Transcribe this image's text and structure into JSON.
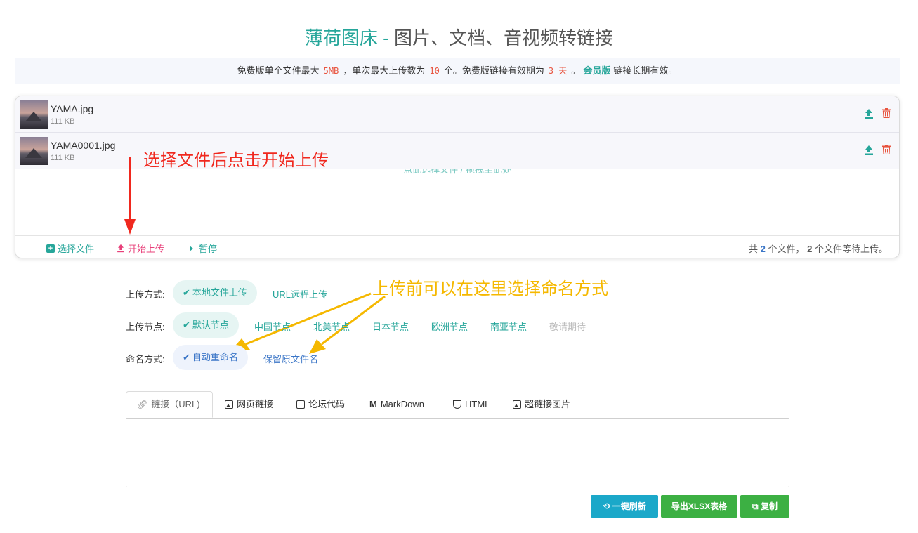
{
  "header": {
    "brand": "薄荷图床",
    "separator": " - ",
    "subtitle": "图片、文档、音视频转链接"
  },
  "notice": {
    "part1": "免费版单个文件最大",
    "max_size": "5MB",
    "part2": "，单次最大上传数为",
    "max_count": "10",
    "part3": "个。免费版链接有效期为",
    "expire": "3 天",
    "part4": "。",
    "vip": "会员版",
    "part5": "链接长期有效。"
  },
  "files": [
    {
      "name": "YAMA.jpg",
      "size": "111 KB"
    },
    {
      "name": "YAMA0001.jpg",
      "size": "111 KB"
    }
  ],
  "uploader": {
    "drop_hint": "点此选择文件 / 拖拽至此处",
    "select_label": "选择文件",
    "start_label": "开始上传",
    "pause_label": "暂停",
    "count_prefix": "共",
    "count_total": "2",
    "count_mid": "个文件，",
    "count_waiting": "2",
    "count_suffix": "个文件等待上传。"
  },
  "annotations": {
    "red": "选择文件后点击开始上传",
    "yellow": "上传前可以在这里选择命名方式"
  },
  "options": {
    "upload_method": {
      "label": "上传方式:",
      "items": [
        "本地文件上传",
        "URL远程上传"
      ],
      "selected": "本地文件上传"
    },
    "upload_node": {
      "label": "上传节点:",
      "items": [
        "默认节点",
        "中国节点",
        "北美节点",
        "日本节点",
        "欧洲节点",
        "南亚节点",
        "敬请期待"
      ],
      "selected": "默认节点"
    },
    "naming": {
      "label": "命名方式:",
      "items": [
        "自动重命名",
        "保留原文件名"
      ],
      "selected": "自动重命名"
    }
  },
  "tabs": [
    {
      "label": "链接（URL)",
      "icon": "link-icon"
    },
    {
      "label": "网页链接",
      "icon": "image-icon"
    },
    {
      "label": "论坛代码",
      "icon": "comment-icon"
    },
    {
      "label": "MarkDown",
      "icon": "markdown-icon"
    },
    {
      "label": "HTML",
      "icon": "html5-icon"
    },
    {
      "label": "超链接图片",
      "icon": "picture-icon"
    }
  ],
  "actions": {
    "refresh": "一键刷新",
    "export": "导出XLSX表格",
    "copy": "复制"
  },
  "colors": {
    "accent": "#26a69a",
    "danger": "#e8407a",
    "annotation_red": "#f0281e",
    "annotation_yellow": "#f5b800",
    "refresh_btn": "#1ba8c9",
    "green_btn": "#3cb043"
  }
}
